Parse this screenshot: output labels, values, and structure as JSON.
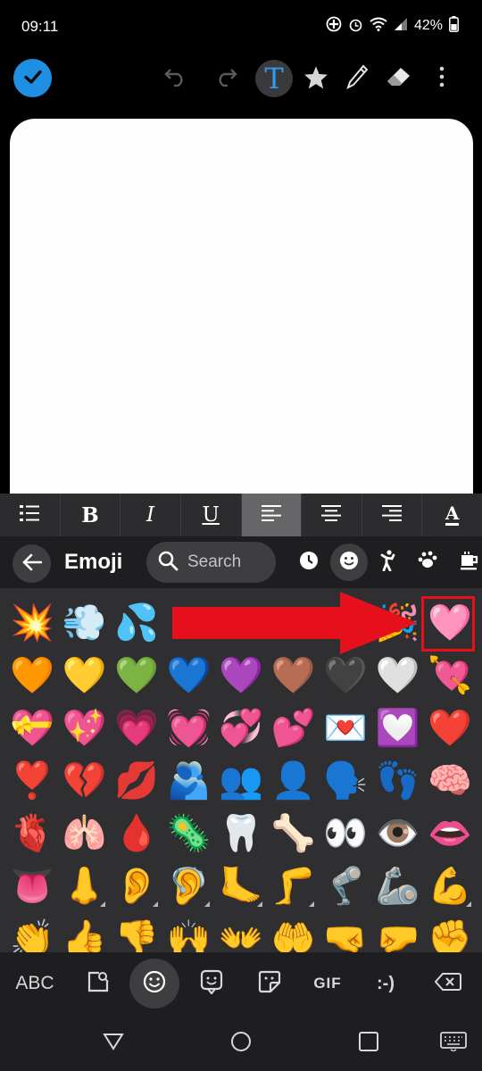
{
  "status_bar": {
    "time": "09:11",
    "battery_percent": "42%",
    "icons": [
      "sync-icon",
      "alarm-icon",
      "wifi-icon",
      "signal-icon",
      "battery-icon"
    ]
  },
  "app_toolbar": {
    "icons": [
      "check-icon",
      "undo-icon",
      "redo-icon",
      "text-icon",
      "star-icon",
      "pen-icon",
      "eraser-icon",
      "more-icon"
    ],
    "text_tool_label": "T",
    "accent_color": "#1f8fe3",
    "text_tool_color": "#2d9cf0"
  },
  "format_bar": {
    "bold": "B",
    "italic": "I",
    "underline": "U",
    "font": "A",
    "icons": [
      "list-icon",
      "align-left-icon",
      "align-center-icon",
      "align-right-icon"
    ],
    "active": "align-left"
  },
  "emoji_panel": {
    "title": "Emoji",
    "search_placeholder": "Search",
    "categories": [
      "recent-icon",
      "smiley-icon",
      "person-icon",
      "animal-icon",
      "food-icon"
    ],
    "active_category": "smiley-icon",
    "rows": [
      [
        "💥",
        "💨",
        "💦",
        "",
        "",
        "",
        "",
        "🎉",
        "🩷"
      ],
      [
        "🧡",
        "💛",
        "💚",
        "💙",
        "💜",
        "🤎",
        "🖤",
        "🤍",
        "💘"
      ],
      [
        "💝",
        "💖",
        "💗",
        "💓",
        "💞",
        "💕",
        "💌",
        "💟",
        "❤️"
      ],
      [
        "❣️",
        "💔",
        "💋",
        "🫂",
        "👥",
        "👤",
        "🗣️",
        "👣",
        "🧠"
      ],
      [
        "🫀",
        "🫁",
        "🩸",
        "🦠",
        "🦷",
        "🦴",
        "👀",
        "👁️",
        "👄"
      ],
      [
        "👅",
        "👃",
        "👂",
        "🦻",
        "🦶",
        "🦵",
        "🦿",
        "🦾",
        "💪"
      ],
      [
        "👏",
        "👍",
        "👎",
        "🙌",
        "👐",
        "🤲",
        "🤜",
        "🤛",
        "✊"
      ]
    ],
    "toned_cells": [
      "5-1",
      "5-2",
      "5-3",
      "5-4",
      "5-5",
      "5-8",
      "6-0",
      "6-1",
      "6-2",
      "6-3",
      "6-4",
      "6-5",
      "6-6",
      "6-7",
      "6-8"
    ],
    "annotation_color": "#e5101b"
  },
  "keyboard_bottom": {
    "abc": "ABC",
    "gif": "GIF",
    "emoticon": ":-)",
    "icons": [
      "image-search-icon",
      "emoji-icon",
      "sticker-icon",
      "sticker-edit-icon",
      "backspace-icon"
    ]
  },
  "nav_bar": {
    "icons": [
      "back-triangle-icon",
      "home-circle-icon",
      "recents-square-icon",
      "keyboard-icon"
    ]
  }
}
